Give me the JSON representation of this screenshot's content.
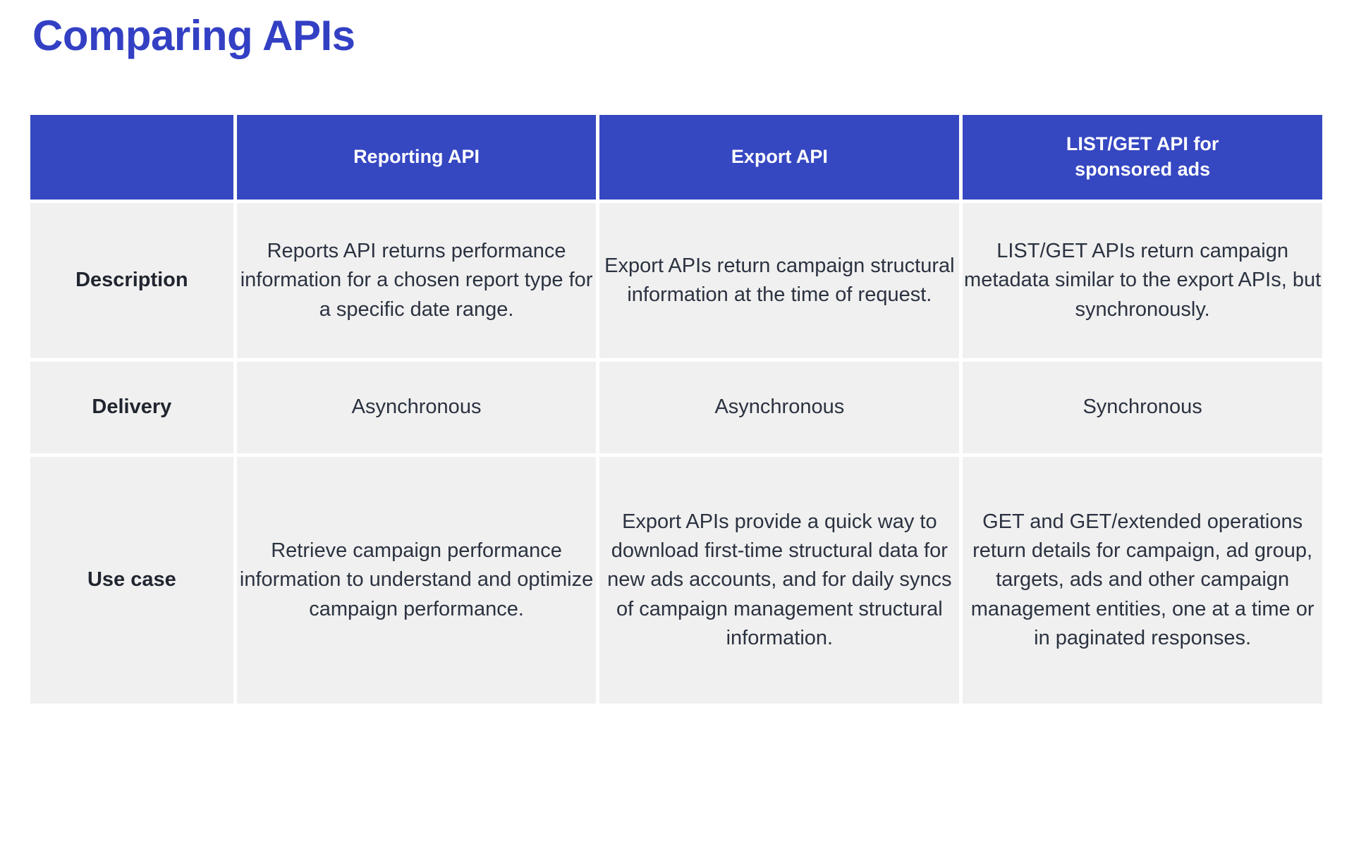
{
  "title": "Comparing APIs",
  "colors": {
    "title": "#3340c4",
    "header_bg": "#3647c2",
    "header_text": "#ffffff",
    "cell_bg": "#f0f0f0",
    "cell_text": "#2b3240",
    "page_bg": "#ffffff"
  },
  "table": {
    "columns": [
      {
        "key": "label",
        "label": ""
      },
      {
        "key": "reporting",
        "label": "Reporting API"
      },
      {
        "key": "export",
        "label": "Export API"
      },
      {
        "key": "listget",
        "label_line1": "LIST/GET API for",
        "label_line2": "sponsored ads",
        "label": "LIST/GET API for sponsored ads"
      }
    ],
    "rows": [
      {
        "label": "Description",
        "reporting": "Reports API returns performance information for a chosen report type for a specific date range.",
        "export": "Export APIs return campaign structural information at the time of request.",
        "listget": "LIST/GET APIs return campaign metadata similar to the export APIs, but synchronously."
      },
      {
        "label": "Delivery",
        "reporting": "Asynchronous",
        "export": "Asynchronous",
        "listget": "Synchronous"
      },
      {
        "label": "Use case",
        "reporting": "Retrieve campaign performance information to understand and optimize campaign performance.",
        "export": "Export APIs provide a quick way to download first-time structural data for new ads accounts, and for daily syncs of campaign management structural information.",
        "listget": "GET and GET/extended operations return details for campaign, ad group, targets, ads and other campaign management entities, one at a time or in paginated responses."
      }
    ]
  }
}
